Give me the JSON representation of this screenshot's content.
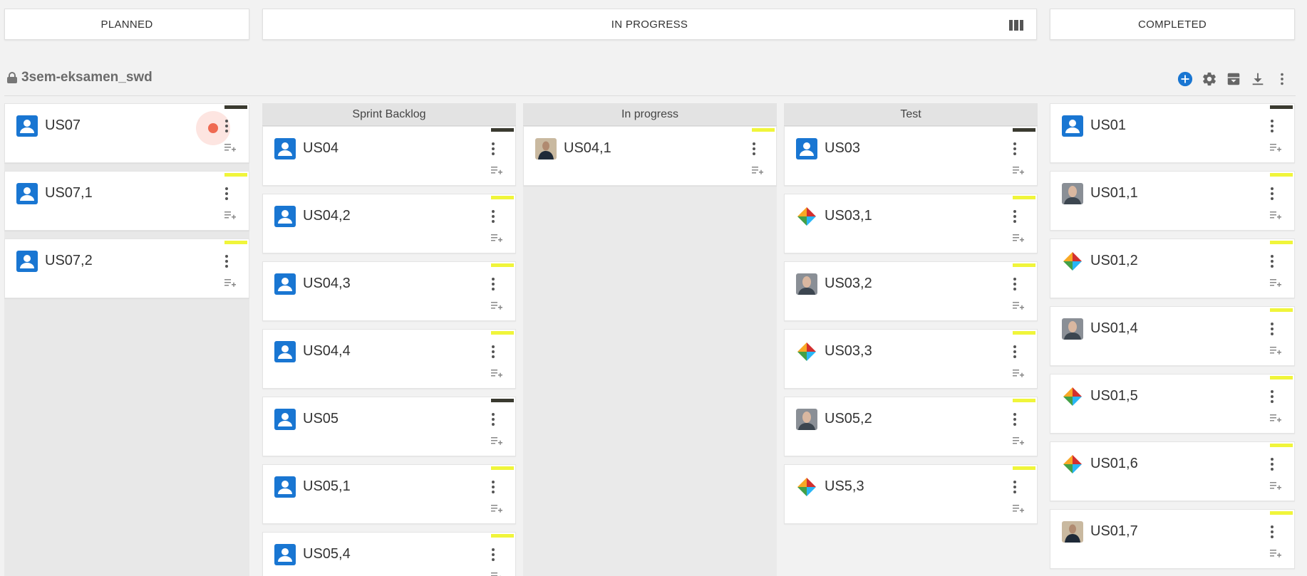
{
  "phases": {
    "planned": "PLANNED",
    "in_progress": "IN PROGRESS",
    "completed": "COMPLETED"
  },
  "board": {
    "title": "3sem-eksamen_swd"
  },
  "toolbar": [
    "add-circle-icon",
    "gear-icon",
    "archive-icon",
    "download-icon",
    "more-vert-icon"
  ],
  "colors": {
    "accent": "#1976d2",
    "tag_yellow": "#f0f53a",
    "tag_dark": "#3a3a30"
  },
  "lanes": {
    "sprint_backlog": "Sprint Backlog",
    "in_progress": "In progress",
    "test": "Test"
  },
  "planned_cards": [
    {
      "label": "US07",
      "avatar": "default",
      "tag": "dark"
    },
    {
      "label": "US07,1",
      "avatar": "default",
      "tag": "yellow"
    },
    {
      "label": "US07,2",
      "avatar": "default",
      "tag": "yellow"
    }
  ],
  "sprint_backlog_cards": [
    {
      "label": "US04",
      "avatar": "default",
      "tag": "dark"
    },
    {
      "label": "US04,2",
      "avatar": "default",
      "tag": "yellow"
    },
    {
      "label": "US04,3",
      "avatar": "default",
      "tag": "yellow"
    },
    {
      "label": "US04,4",
      "avatar": "default",
      "tag": "yellow"
    },
    {
      "label": "US05",
      "avatar": "default",
      "tag": "dark"
    },
    {
      "label": "US05,1",
      "avatar": "default",
      "tag": "yellow"
    },
    {
      "label": "US05,4",
      "avatar": "default",
      "tag": "yellow"
    }
  ],
  "in_progress_cards": [
    {
      "label": "US04,1",
      "avatar": "photo-dark",
      "tag": "yellow"
    }
  ],
  "test_cards": [
    {
      "label": "US03",
      "avatar": "default",
      "tag": "dark"
    },
    {
      "label": "US03,1",
      "avatar": "logo",
      "tag": "yellow"
    },
    {
      "label": "US03,2",
      "avatar": "photo",
      "tag": "yellow"
    },
    {
      "label": "US03,3",
      "avatar": "logo",
      "tag": "yellow"
    },
    {
      "label": "US05,2",
      "avatar": "photo",
      "tag": "yellow"
    },
    {
      "label": "US5,3",
      "avatar": "logo",
      "tag": "yellow"
    }
  ],
  "completed_cards": [
    {
      "label": "US01",
      "avatar": "default",
      "tag": "dark"
    },
    {
      "label": "US01,1",
      "avatar": "photo",
      "tag": "yellow"
    },
    {
      "label": "US01,2",
      "avatar": "logo",
      "tag": "yellow"
    },
    {
      "label": "US01,4",
      "avatar": "photo",
      "tag": "yellow"
    },
    {
      "label": "US01,5",
      "avatar": "logo",
      "tag": "yellow"
    },
    {
      "label": "US01,6",
      "avatar": "logo",
      "tag": "yellow"
    },
    {
      "label": "US01,7",
      "avatar": "photo-dark",
      "tag": "yellow"
    }
  ]
}
